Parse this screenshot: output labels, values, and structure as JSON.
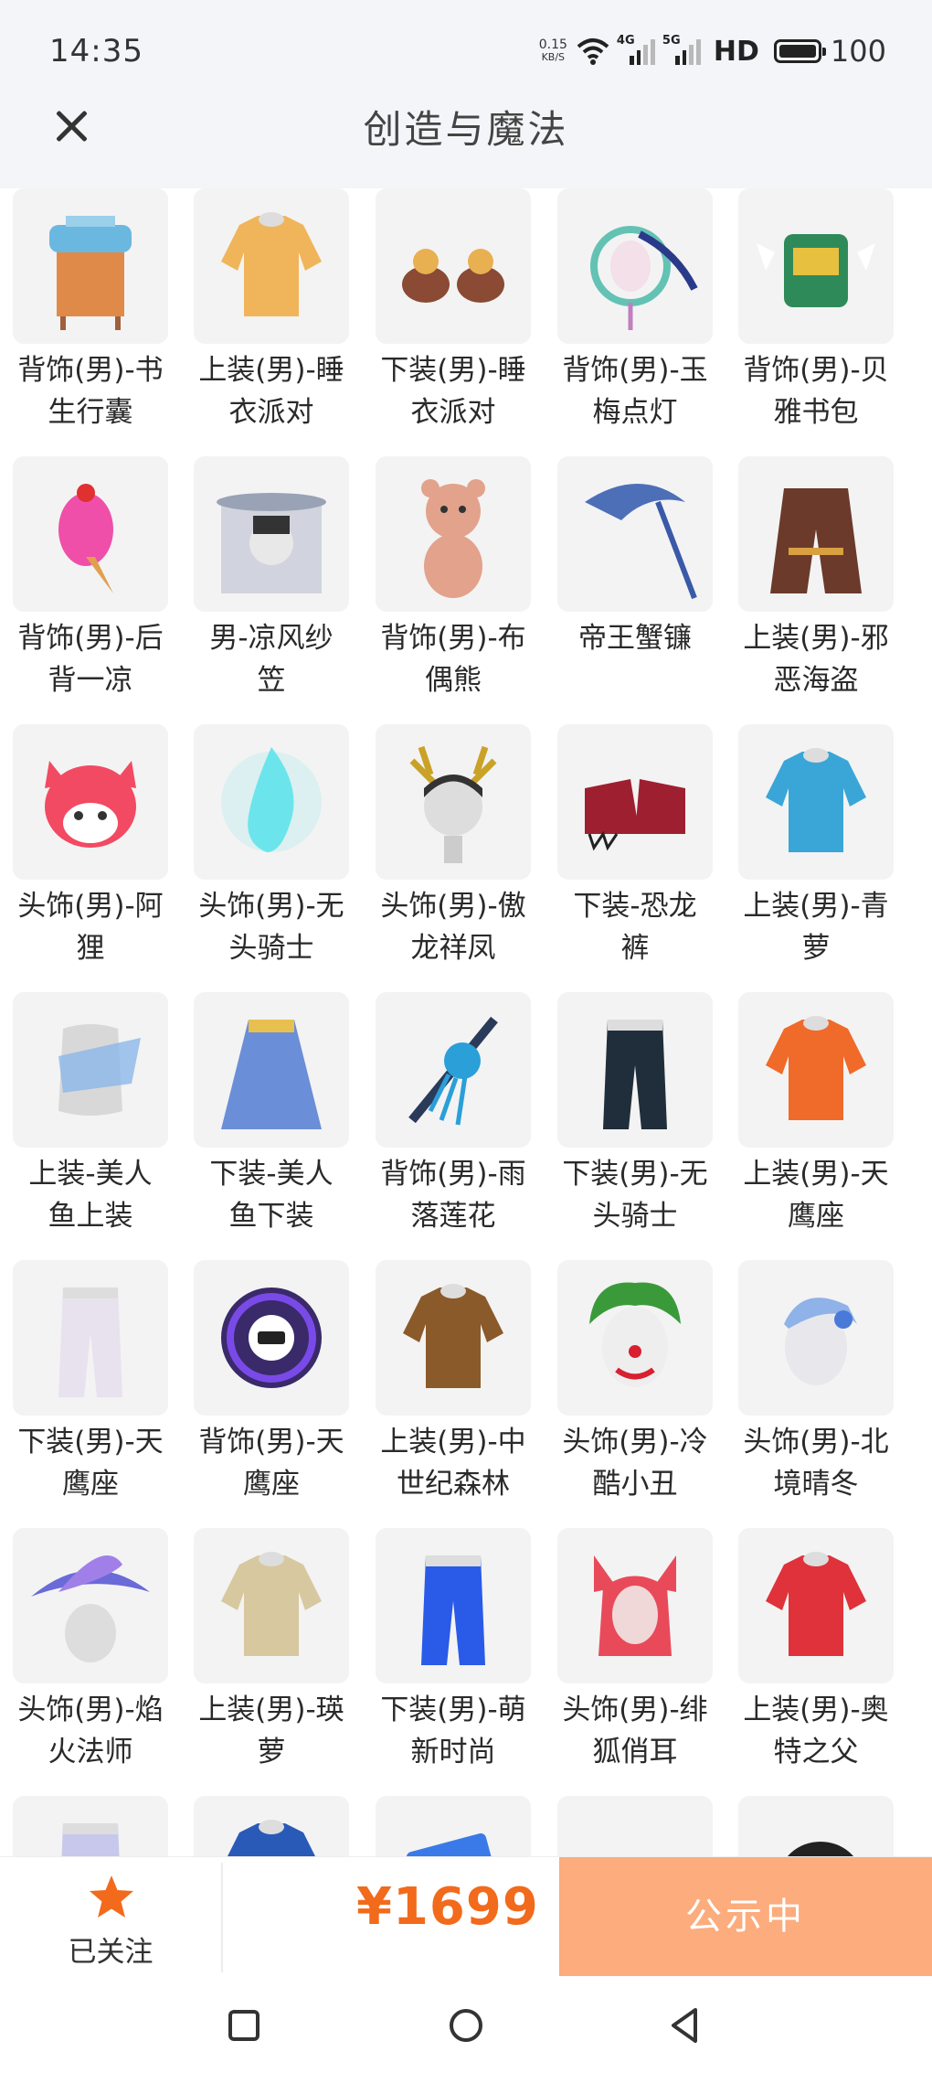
{
  "status": {
    "time": "14:35",
    "net_speed_value": "0.15",
    "net_speed_unit": "KB/S",
    "sig1_label": "4G",
    "sig2_label": "5G",
    "hd": "HD",
    "battery": "100"
  },
  "header": {
    "title": "创造与魔法",
    "close_icon": "close-icon"
  },
  "items": [
    {
      "line1": "背饰(男)-书",
      "line2": "生行囊",
      "icon": "book-cart",
      "color": "#6ab8e0"
    },
    {
      "line1": "上装(男)-睡",
      "line2": "衣派对",
      "icon": "top",
      "color": "#f0b55a"
    },
    {
      "line1": "下装(男)-睡",
      "line2": "衣派对",
      "icon": "shoes",
      "color": "#8a4a33"
    },
    {
      "line1": "背饰(男)-玉",
      "line2": "梅点灯",
      "icon": "lantern",
      "color": "#63c2b4"
    },
    {
      "line1": "背饰(男)-贝",
      "line2": "雅书包",
      "icon": "backpack",
      "color": "#2f8a5a"
    },
    {
      "line1": "背饰(男)-后",
      "line2": "背一凉",
      "icon": "icecream",
      "color": "#ef4fa8"
    },
    {
      "line1": "男-凉风纱",
      "line2": "笠",
      "icon": "hat-veil",
      "color": "#9aa2b5"
    },
    {
      "line1": "背饰(男)-布",
      "line2": "偶熊",
      "icon": "bear",
      "color": "#e2a28c"
    },
    {
      "line1": "帝王蟹镰",
      "line2": "",
      "icon": "scythe",
      "color": "#4d6fb8"
    },
    {
      "line1": "上装(男)-邪",
      "line2": "恶海盗",
      "icon": "coat",
      "color": "#6b3a2a"
    },
    {
      "line1": "头饰(男)-阿",
      "line2": "狸",
      "icon": "fox-head",
      "color": "#f24a62"
    },
    {
      "line1": "头饰(男)-无",
      "line2": "头骑士",
      "icon": "flame",
      "color": "#5fe3ea"
    },
    {
      "line1": "头饰(男)-傲",
      "line2": "龙祥凤",
      "icon": "head-antler",
      "color": "#c9a227"
    },
    {
      "line1": "下装-恐龙",
      "line2": "裤",
      "icon": "claws",
      "color": "#9e2030"
    },
    {
      "line1": "上装(男)-青",
      "line2": "萝",
      "icon": "top",
      "color": "#3aa6d8"
    },
    {
      "line1": "上装-美人",
      "line2": "鱼上装",
      "icon": "torso",
      "color": "#8bb8e8"
    },
    {
      "line1": "下装-美人",
      "line2": "鱼下装",
      "icon": "skirt",
      "color": "#6a8ed8"
    },
    {
      "line1": "背饰(男)-雨",
      "line2": "落莲花",
      "icon": "flute",
      "color": "#2a9fd8"
    },
    {
      "line1": "下装(男)-无",
      "line2": "头骑士",
      "icon": "pants",
      "color": "#1f2e3a"
    },
    {
      "line1": "上装(男)-天",
      "line2": "鹰座",
      "icon": "top",
      "color": "#f06a2a"
    },
    {
      "line1": "下装(男)-天",
      "line2": "鹰座",
      "icon": "pants",
      "color": "#e8e2ee"
    },
    {
      "line1": "背饰(男)-天",
      "line2": "鹰座",
      "icon": "pod",
      "color": "#7a4ae8"
    },
    {
      "line1": "上装(男)-中",
      "line2": "世纪森林",
      "icon": "top",
      "color": "#8a5a2a"
    },
    {
      "line1": "头饰(男)-冷",
      "line2": "酷小丑",
      "icon": "clown",
      "color": "#3a9a3a"
    },
    {
      "line1": "头饰(男)-北",
      "line2": "境晴冬",
      "icon": "head-blue",
      "color": "#8fb2e8"
    },
    {
      "line1": "头饰(男)-焰",
      "line2": "火法师",
      "icon": "wizard-hat",
      "color": "#6a6ad8"
    },
    {
      "line1": "上装(男)-瑛",
      "line2": "萝",
      "icon": "top",
      "color": "#d8c8a0"
    },
    {
      "line1": "下装(男)-萌",
      "line2": "新时尚",
      "icon": "pants",
      "color": "#2a5ae8"
    },
    {
      "line1": "头饰(男)-绯",
      "line2": "狐俏耳",
      "icon": "fox-ears",
      "color": "#e84a5a"
    },
    {
      "line1": "上装(男)-奥",
      "line2": "特之父",
      "icon": "top",
      "color": "#e0323a"
    },
    {
      "line1": "",
      "line2": "",
      "icon": "pants",
      "color": "#c8c8ec"
    },
    {
      "line1": "",
      "line2": "",
      "icon": "top",
      "color": "#2a5ab8"
    },
    {
      "line1": "",
      "line2": "",
      "icon": "card",
      "color": "#3a7ae8"
    },
    {
      "line1": "",
      "line2": "",
      "icon": "shoes",
      "color": "#d8303a"
    },
    {
      "line1": "",
      "line2": "",
      "icon": "hat",
      "color": "#222222"
    }
  ],
  "bottom": {
    "follow_label": "已关注",
    "price": "¥1699",
    "status_button": "公示中"
  },
  "colors": {
    "accent": "#f26a1b",
    "status_button_bg": "#fcac7d"
  }
}
